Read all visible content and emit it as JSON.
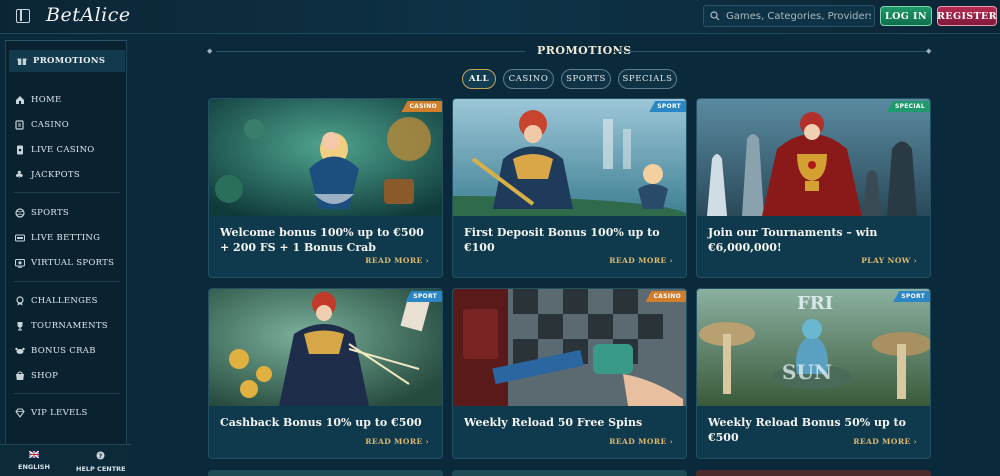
{
  "header": {
    "logo": "BetAlice",
    "search_placeholder": "Games, Categories, Providers",
    "login_label": "LOG IN",
    "register_label": "REGISTER"
  },
  "sidebar": {
    "promo_label": "PROMOTIONS",
    "items": [
      {
        "label": "HOME",
        "icon": "home-icon"
      },
      {
        "label": "CASINO",
        "icon": "casino-icon"
      },
      {
        "label": "LIVE CASINO",
        "icon": "live-casino-icon"
      },
      {
        "label": "JACKPOTS",
        "icon": "clover-icon"
      },
      {
        "label": "SPORTS",
        "icon": "ball-icon"
      },
      {
        "label": "LIVE BETTING",
        "icon": "live-betting-icon"
      },
      {
        "label": "VIRTUAL SPORTS",
        "icon": "virtual-sports-icon"
      },
      {
        "label": "CHALLENGES",
        "icon": "medal-icon"
      },
      {
        "label": "TOURNAMENTS",
        "icon": "trophy-icon"
      },
      {
        "label": "BONUS CRAB",
        "icon": "crab-icon"
      },
      {
        "label": "SHOP",
        "icon": "shop-icon"
      },
      {
        "label": "VIP LEVELS",
        "icon": "diamond-icon"
      }
    ],
    "footer": {
      "language_label": "ENGLISH",
      "help_label": "HELP CENTRE"
    }
  },
  "main": {
    "title": "PROMOTIONS",
    "tabs": [
      "ALL",
      "CASINO",
      "SPORTS",
      "SPECIALS"
    ],
    "active_tab": "ALL",
    "cards": [
      {
        "badge": "CASINO",
        "title": "Welcome bonus 100% up to €500 + 200 FS + 1 Bonus Crab",
        "link": "READ MORE"
      },
      {
        "badge": "SPORT",
        "title": "First Deposit Bonus 100% up to €100",
        "link": "READ MORE"
      },
      {
        "badge": "SPECIAL",
        "title": "Join our Tournaments – win €6,000,000!",
        "link": "PLAY NOW"
      },
      {
        "badge": "SPORT",
        "title": "Cashback Bonus 10% up to €500",
        "link": "READ MORE"
      },
      {
        "badge": "CASINO",
        "title": "Weekly Reload 50 Free Spins",
        "link": "READ MORE"
      },
      {
        "badge": "SPORT",
        "title": "Weekly Reload Bonus 50% up to €500",
        "link": "READ MORE"
      }
    ]
  },
  "colors": {
    "background": "#0a2a3c",
    "login": "#1e9a6a",
    "register": "#b52a52",
    "accent_gold": "#e0b86c",
    "badge_casino": "#d07e2c",
    "badge_sport": "#2a86c4",
    "badge_special": "#1f9a6c"
  }
}
